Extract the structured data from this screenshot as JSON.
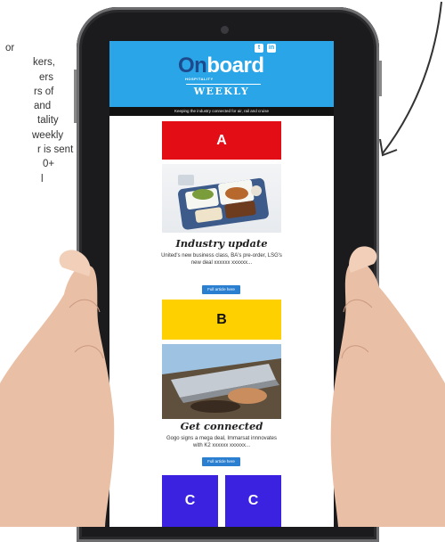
{
  "side_text": [
    "or",
    "kers,",
    "ers",
    "rs of",
    "and",
    "tality",
    "weekly",
    "r is sent",
    "0+",
    "l"
  ],
  "newsletter": {
    "logo_on": "On",
    "logo_rest": "board",
    "logo_sub": "HOSPITALITY",
    "weekly": "WEEKLY",
    "tagline": "Keeping the industry connected for air, rail and cruise",
    "social": {
      "twitter": "t",
      "linkedin": "in"
    }
  },
  "ads": {
    "a": "A",
    "b": "B",
    "c1": "C",
    "c2": "C"
  },
  "articles": [
    {
      "title": "Industry update",
      "body": "United's new business class, BA's pre-order, LSG's new deal xxxxxx xxxxxx...",
      "cta": "Full article here"
    },
    {
      "title": "Get connected",
      "body": "Gogo signs a mega deal, Immarsat innnovates with K2 xxxxxx xxxxxx...",
      "cta": "Full article here"
    }
  ],
  "colors": {
    "masthead": "#2aa6e8",
    "ad_a": "#e30d16",
    "ad_b": "#ffd000",
    "ad_c": "#3a22e0",
    "cta": "#2a7fd0"
  }
}
